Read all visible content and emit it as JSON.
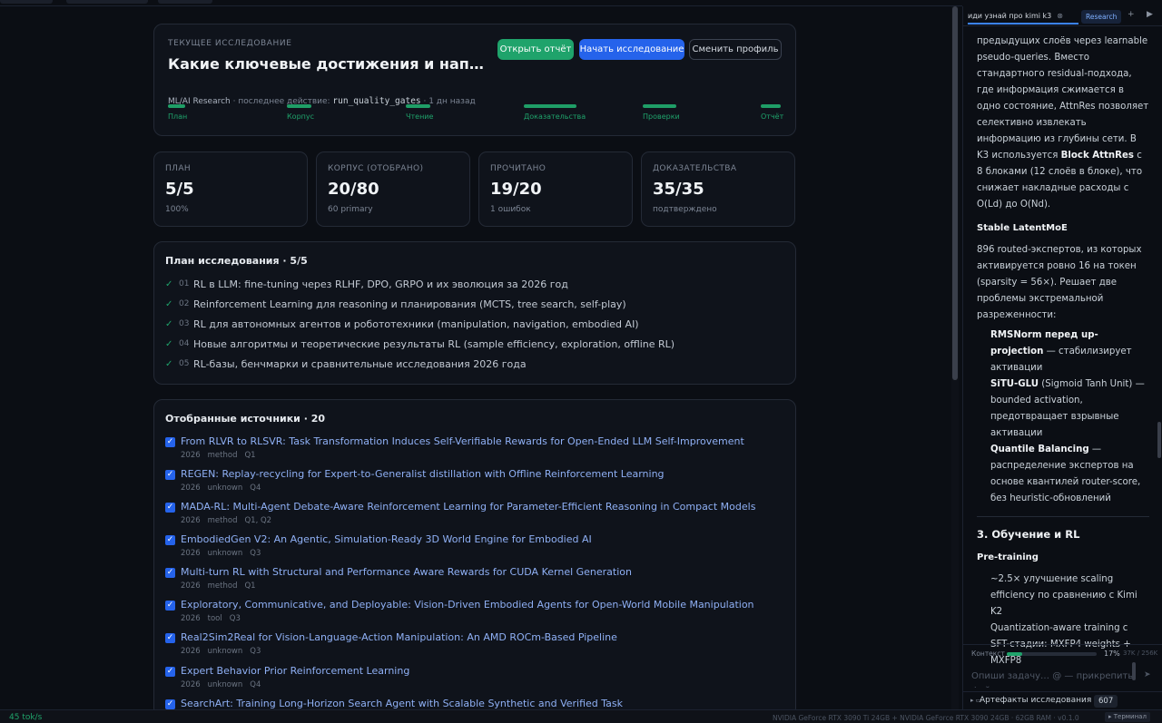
{
  "header": {
    "overline": "ТЕКУЩЕЕ ИССЛЕДОВАНИЕ",
    "title": "Какие ключевые достижения и направлен…",
    "area": "ML/AI Research",
    "meta_mid": " · последнее действие: ",
    "last_action": "run_quality_gates",
    "meta_end": " · 1 дн назад",
    "buttons": {
      "report": "Открыть отчёт",
      "start": "Начать исследование",
      "profile": "Сменить профиль"
    },
    "steps": [
      "План",
      "Корпус",
      "Чтение",
      "Доказательства",
      "Проверки",
      "Отчёт"
    ],
    "progress": 1.0
  },
  "stats": [
    {
      "label": "ПЛАН",
      "value": "5/5",
      "sub": "100%"
    },
    {
      "label": "КОРПУС (ОТОБРАНО)",
      "value": "20/80",
      "sub": "60 primary"
    },
    {
      "label": "ПРОЧИТАНО",
      "value": "19/20",
      "sub": "1 ошибок"
    },
    {
      "label": "ДОКАЗАТЕЛЬСТВА",
      "value": "35/35",
      "sub": "подтверждено"
    }
  ],
  "plan": {
    "title": "План исследования · 5/5",
    "items": [
      {
        "num": "01",
        "text": "RL в LLM: fine-tuning через RLHF, DPO, GRPO и их эволюция за 2026 год"
      },
      {
        "num": "02",
        "text": "Reinforcement Learning для reasoning и планирования (MCTS, tree search, self-play)"
      },
      {
        "num": "03",
        "text": "RL для автономных агентов и робототехники (manipulation, navigation, embodied AI)"
      },
      {
        "num": "04",
        "text": "Новые алгоритмы и теоретические результаты RL (sample efficiency, exploration, offline RL)"
      },
      {
        "num": "05",
        "text": "RL-базы, бенчмарки и сравнительные исследования 2026 года"
      }
    ]
  },
  "sources": {
    "title": "Отобранные источники · 20",
    "items": [
      {
        "title": "From RLVR to RLSVR: Task Transformation Induces Self-Verifiable Rewards for Open-Ended LLM Self-Improvement",
        "year": "2026",
        "type": "method",
        "q": "Q1"
      },
      {
        "title": "REGEN: Replay-recycling for Expert-to-Generalist distillation with Offline Reinforcement Learning",
        "year": "2026",
        "type": "unknown",
        "q": "Q4"
      },
      {
        "title": "MADA-RL: Multi-Agent Debate-Aware Reinforcement Learning for Parameter-Efficient Reasoning in Compact Models",
        "year": "2026",
        "type": "method",
        "q": "Q1, Q2"
      },
      {
        "title": "EmbodiedGen V2: An Agentic, Simulation-Ready 3D World Engine for Embodied AI",
        "year": "2026",
        "type": "unknown",
        "q": "Q3"
      },
      {
        "title": "Multi-turn RL with Structural and Performance Aware Rewards for CUDA Kernel Generation",
        "year": "2026",
        "type": "method",
        "q": "Q1"
      },
      {
        "title": "Exploratory, Communicative, and Deployable: Vision-Driven Embodied Agents for Open-World Mobile Manipulation",
        "year": "2026",
        "type": "tool",
        "q": "Q3"
      },
      {
        "title": "Real2Sim2Real for Vision-Language-Action Manipulation: An AMD ROCm-Based Pipeline",
        "year": "2026",
        "type": "unknown",
        "q": "Q3"
      },
      {
        "title": "Expert Behavior Prior Reinforcement Learning",
        "year": "2026",
        "type": "unknown",
        "q": "Q4"
      },
      {
        "title": "SearchArt: Training Long-Horizon Search Agent with Scalable Synthetic and Verified Task",
        "year": "",
        "type": "",
        "q": ""
      }
    ]
  },
  "chat": {
    "tab_title": "иди узнай про kimi k3",
    "mode": "Research",
    "p1": "предыдущих слоёв через learnable pseudo-queries. Вместо стандартного residual-подхода, где информация сжимается в одно состояние, AttnRes позволяет селективно извлекать информацию из глубины сети. В K3 используется ",
    "p1_bold": "Block AttnRes",
    "p1_end": " с 8 блоками (12 слоёв в блоке), что снижает накладные расходы с O(Ld) до O(Nd).",
    "h_moe": "Stable LatentMoE",
    "p2": "896 routed-экспертов, из которых активируется ровно 16 на токен (sparsity = 56×). Решает две проблемы экстремальной разреженности:",
    "li1_b": "RMSNorm перед up-projection",
    "li1": " — стабилизирует активации",
    "li2_b": "SiTU-GLU",
    "li2": " (Sigmoid Tanh Unit) — bounded activation, предотвращает взрывные активации",
    "li3_b": "Quantile Balancing",
    "li3": " — распределение экспертов на основе квантилей router-score, без heuristic-обновлений",
    "h3": "3. Обучение и RL",
    "h_pre": "Pre-training",
    "li4": "~2.5× улучшение scaling efficiency по сравнению с Kimi K2",
    "li5": "Quantization-aware training с SFT-стадии: MXFP4 weights + MXFP8",
    "context_label": "Контекст",
    "context_pct": "17%",
    "context_fraction": 0.17,
    "context_tokens": "37K / 256K",
    "input_placeholder": "Опиши задачу… @ — прикрепить файл",
    "artifacts_label": "Артефакты исследования",
    "artifacts_count": "607"
  },
  "status": {
    "tps": "45 tok/s",
    "gpu": "NVIDIA GeForce RTX 3090 Ti 24GB + NVIDIA GeForce RTX 3090 24GB · 62GB RAM · v0.1.0",
    "terminal": "▸ Терминал"
  },
  "colors": {
    "accent_green": "#1fa36b",
    "accent_blue": "#2563eb",
    "link": "#8fb0f5",
    "bg": "#0b0e14"
  },
  "icons": {
    "check": "check-icon",
    "checkbox": "checkbox-icon",
    "plus": "plus-icon",
    "play": "play-icon",
    "send": "send-icon",
    "close": "close-icon"
  }
}
